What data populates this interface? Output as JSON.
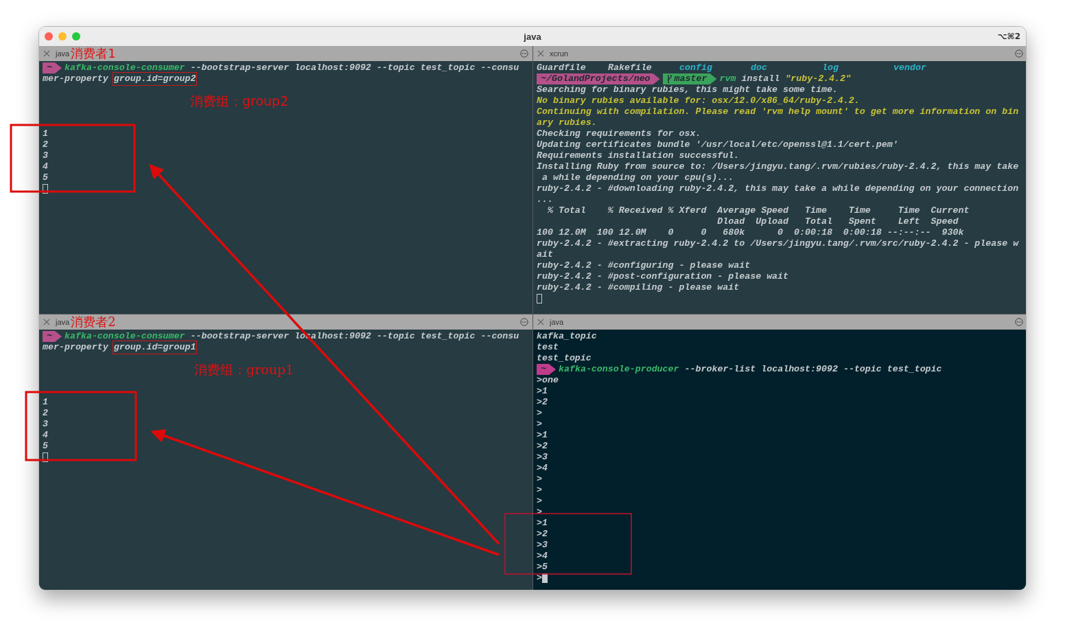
{
  "window": {
    "title": "java",
    "shortcut": "⌥⌘2"
  },
  "panes": [
    {
      "tab": "java",
      "note": "消费者1",
      "kind": "slate",
      "annotation": {
        "text": "消费组：group2"
      },
      "lines": [
        {
          "kind": "text",
          "segments": [
            {
              "kind": "badge",
              "text": "~",
              "color": "#b5508a"
            },
            {
              "kind": "command",
              "text": "kafka-console-consumer"
            },
            {
              "kind": "plain",
              "text": " --bootstrap-server localhost:9092 --topic test_topic --consu"
            }
          ]
        },
        {
          "kind": "text",
          "segments": [
            {
              "kind": "plain",
              "text": "mer-property "
            },
            {
              "kind": "plain",
              "text": "group.id=group2",
              "boxed": true
            }
          ]
        },
        {
          "kind": "blank"
        },
        {
          "kind": "blank"
        },
        {
          "kind": "blank"
        },
        {
          "kind": "blank"
        },
        {
          "kind": "text",
          "segments": [
            {
              "kind": "plain",
              "text": "1"
            }
          ]
        },
        {
          "kind": "text",
          "segments": [
            {
              "kind": "plain",
              "text": "2"
            }
          ]
        },
        {
          "kind": "text",
          "segments": [
            {
              "kind": "plain",
              "text": "3"
            }
          ]
        },
        {
          "kind": "text",
          "segments": [
            {
              "kind": "plain",
              "text": "4"
            }
          ]
        },
        {
          "kind": "text",
          "segments": [
            {
              "kind": "plain",
              "text": "5"
            }
          ]
        },
        {
          "kind": "text",
          "segments": [
            {
              "kind": "cursor",
              "filled": false
            }
          ]
        }
      ]
    },
    {
      "tab": "xcrun",
      "kind": "slate",
      "lines": [
        {
          "kind": "columns",
          "items": [
            {
              "text": "Guardfile",
              "kind": "plain"
            },
            {
              "text": "Rakefile",
              "kind": "plain"
            },
            {
              "text": "config",
              "kind": "directory"
            },
            {
              "text": "doc",
              "kind": "directory"
            },
            {
              "text": "log",
              "kind": "directory"
            },
            {
              "text": "vendor",
              "kind": "directory"
            }
          ]
        },
        {
          "kind": "text",
          "segments": [
            {
              "kind": "badge",
              "text": "~/GolandProjects/neo",
              "color": "#b5508a"
            },
            {
              "kind": "badge",
              "text": "master",
              "color": "#3aa35c",
              "branch": true
            },
            {
              "kind": "command",
              "text": "rvm"
            },
            {
              "kind": "plain",
              "text": " install "
            },
            {
              "kind": "string",
              "text": "\"ruby-2.4.2\""
            }
          ]
        },
        {
          "kind": "text",
          "segments": [
            {
              "kind": "plain",
              "text": "Searching for binary rubies, this might take some time."
            }
          ]
        },
        {
          "kind": "text",
          "segments": [
            {
              "kind": "warning",
              "text": "No binary rubies available for: osx/12.0/x86_64/ruby-2.4.2."
            }
          ]
        },
        {
          "kind": "text",
          "segments": [
            {
              "kind": "warning",
              "text": "Continuing with compilation. Please read 'rvm help mount' to get more information on bin"
            }
          ]
        },
        {
          "kind": "text",
          "segments": [
            {
              "kind": "warning",
              "text": "ary rubies."
            }
          ]
        },
        {
          "kind": "text",
          "segments": [
            {
              "kind": "plain",
              "text": "Checking requirements for osx."
            }
          ]
        },
        {
          "kind": "text",
          "segments": [
            {
              "kind": "plain",
              "text": "Updating certificates bundle '/usr/local/etc/openssl@1.1/cert.pem'"
            }
          ]
        },
        {
          "kind": "text",
          "segments": [
            {
              "kind": "plain",
              "text": "Requirements installation successful."
            }
          ]
        },
        {
          "kind": "text",
          "segments": [
            {
              "kind": "plain",
              "text": "Installing Ruby from source to: /Users/jingyu.tang/.rvm/rubies/ruby-2.4.2, this may take"
            }
          ]
        },
        {
          "kind": "text",
          "segments": [
            {
              "kind": "plain",
              "text": " a while depending on your cpu(s)..."
            }
          ]
        },
        {
          "kind": "text",
          "segments": [
            {
              "kind": "plain",
              "text": "ruby-2.4.2 - #downloading ruby-2.4.2, this may take a while depending on your connection"
            }
          ]
        },
        {
          "kind": "text",
          "segments": [
            {
              "kind": "plain",
              "text": "..."
            }
          ]
        },
        {
          "kind": "text",
          "segments": [
            {
              "kind": "plain",
              "text": "  % Total    % Received % Xferd  Average Speed   Time    Time     Time  Current"
            }
          ]
        },
        {
          "kind": "text",
          "segments": [
            {
              "kind": "plain",
              "text": "                                 Dload  Upload   Total   Spent    Left  Speed"
            }
          ]
        },
        {
          "kind": "text",
          "segments": [
            {
              "kind": "plain",
              "text": "100 12.0M  100 12.0M    0     0   680k      0  0:00:18  0:00:18 --:--:--  930k"
            }
          ]
        },
        {
          "kind": "text",
          "segments": [
            {
              "kind": "plain",
              "text": "ruby-2.4.2 - #extracting ruby-2.4.2 to /Users/jingyu.tang/.rvm/src/ruby-2.4.2 - please w"
            }
          ]
        },
        {
          "kind": "text",
          "segments": [
            {
              "kind": "plain",
              "text": "ait"
            }
          ]
        },
        {
          "kind": "text",
          "segments": [
            {
              "kind": "plain",
              "text": "ruby-2.4.2 - #configuring - please wait"
            }
          ]
        },
        {
          "kind": "text",
          "segments": [
            {
              "kind": "plain",
              "text": "ruby-2.4.2 - #post-configuration - please wait"
            }
          ]
        },
        {
          "kind": "text",
          "segments": [
            {
              "kind": "plain",
              "text": "ruby-2.4.2 - #compiling - please wait"
            }
          ]
        },
        {
          "kind": "text",
          "segments": [
            {
              "kind": "cursor",
              "filled": false
            }
          ]
        }
      ]
    },
    {
      "tab": "java",
      "note": "消费者2",
      "kind": "slate",
      "annotation": {
        "text": "消费组：group1"
      },
      "lines": [
        {
          "kind": "text",
          "segments": [
            {
              "kind": "badge",
              "text": "~",
              "color": "#b5508a"
            },
            {
              "kind": "command",
              "text": "kafka-console-consumer"
            },
            {
              "kind": "plain",
              "text": " --bootstrap-server localhost:9092 --topic test_topic --consu"
            }
          ]
        },
        {
          "kind": "text",
          "segments": [
            {
              "kind": "plain",
              "text": "mer-property "
            },
            {
              "kind": "plain",
              "text": "group.id=group1",
              "boxed": true
            }
          ]
        },
        {
          "kind": "blank"
        },
        {
          "kind": "blank"
        },
        {
          "kind": "blank"
        },
        {
          "kind": "blank"
        },
        {
          "kind": "text",
          "segments": [
            {
              "kind": "plain",
              "text": "1"
            }
          ]
        },
        {
          "kind": "text",
          "segments": [
            {
              "kind": "plain",
              "text": "2"
            }
          ]
        },
        {
          "kind": "text",
          "segments": [
            {
              "kind": "plain",
              "text": "3"
            }
          ]
        },
        {
          "kind": "text",
          "segments": [
            {
              "kind": "plain",
              "text": "4"
            }
          ]
        },
        {
          "kind": "text",
          "segments": [
            {
              "kind": "plain",
              "text": "5"
            }
          ]
        },
        {
          "kind": "text",
          "segments": [
            {
              "kind": "cursor",
              "filled": false
            }
          ]
        }
      ]
    },
    {
      "tab": "java",
      "kind": "navy",
      "lines": [
        {
          "kind": "text",
          "segments": [
            {
              "kind": "plain",
              "text": "kafka_topic"
            }
          ]
        },
        {
          "kind": "text",
          "segments": [
            {
              "kind": "plain",
              "text": "test"
            }
          ]
        },
        {
          "kind": "text",
          "segments": [
            {
              "kind": "plain",
              "text": "test_topic"
            }
          ]
        },
        {
          "kind": "text",
          "segments": [
            {
              "kind": "badge",
              "text": "~",
              "color": "#c03c8a"
            },
            {
              "kind": "command",
              "text": "kafka-console-producer"
            },
            {
              "kind": "plain",
              "text": " --broker-list localhost:9092 --topic test_topic"
            }
          ]
        },
        {
          "kind": "text",
          "segments": [
            {
              "kind": "plain",
              "text": ">one"
            }
          ]
        },
        {
          "kind": "text",
          "segments": [
            {
              "kind": "plain",
              "text": ">1"
            }
          ]
        },
        {
          "kind": "text",
          "segments": [
            {
              "kind": "plain",
              "text": ">2"
            }
          ]
        },
        {
          "kind": "text",
          "segments": [
            {
              "kind": "plain",
              "text": ">"
            }
          ]
        },
        {
          "kind": "text",
          "segments": [
            {
              "kind": "plain",
              "text": ">"
            }
          ]
        },
        {
          "kind": "text",
          "segments": [
            {
              "kind": "plain",
              "text": ">1"
            }
          ]
        },
        {
          "kind": "text",
          "segments": [
            {
              "kind": "plain",
              "text": ">2"
            }
          ]
        },
        {
          "kind": "text",
          "segments": [
            {
              "kind": "plain",
              "text": ">3"
            }
          ]
        },
        {
          "kind": "text",
          "segments": [
            {
              "kind": "plain",
              "text": ">4"
            }
          ]
        },
        {
          "kind": "text",
          "segments": [
            {
              "kind": "plain",
              "text": ">"
            }
          ]
        },
        {
          "kind": "text",
          "segments": [
            {
              "kind": "plain",
              "text": ">"
            }
          ]
        },
        {
          "kind": "text",
          "segments": [
            {
              "kind": "plain",
              "text": ">"
            }
          ]
        },
        {
          "kind": "text",
          "segments": [
            {
              "kind": "plain",
              "text": ">"
            }
          ]
        },
        {
          "kind": "text",
          "segments": [
            {
              "kind": "plain",
              "text": ">1"
            }
          ]
        },
        {
          "kind": "text",
          "segments": [
            {
              "kind": "plain",
              "text": ">2"
            }
          ]
        },
        {
          "kind": "text",
          "segments": [
            {
              "kind": "plain",
              "text": ">3"
            }
          ]
        },
        {
          "kind": "text",
          "segments": [
            {
              "kind": "plain",
              "text": ">4"
            }
          ]
        },
        {
          "kind": "text",
          "segments": [
            {
              "kind": "plain",
              "text": ">5"
            }
          ]
        },
        {
          "kind": "text",
          "segments": [
            {
              "kind": "plain",
              "text": ">"
            },
            {
              "kind": "cursor",
              "filled": true
            }
          ]
        }
      ]
    }
  ]
}
